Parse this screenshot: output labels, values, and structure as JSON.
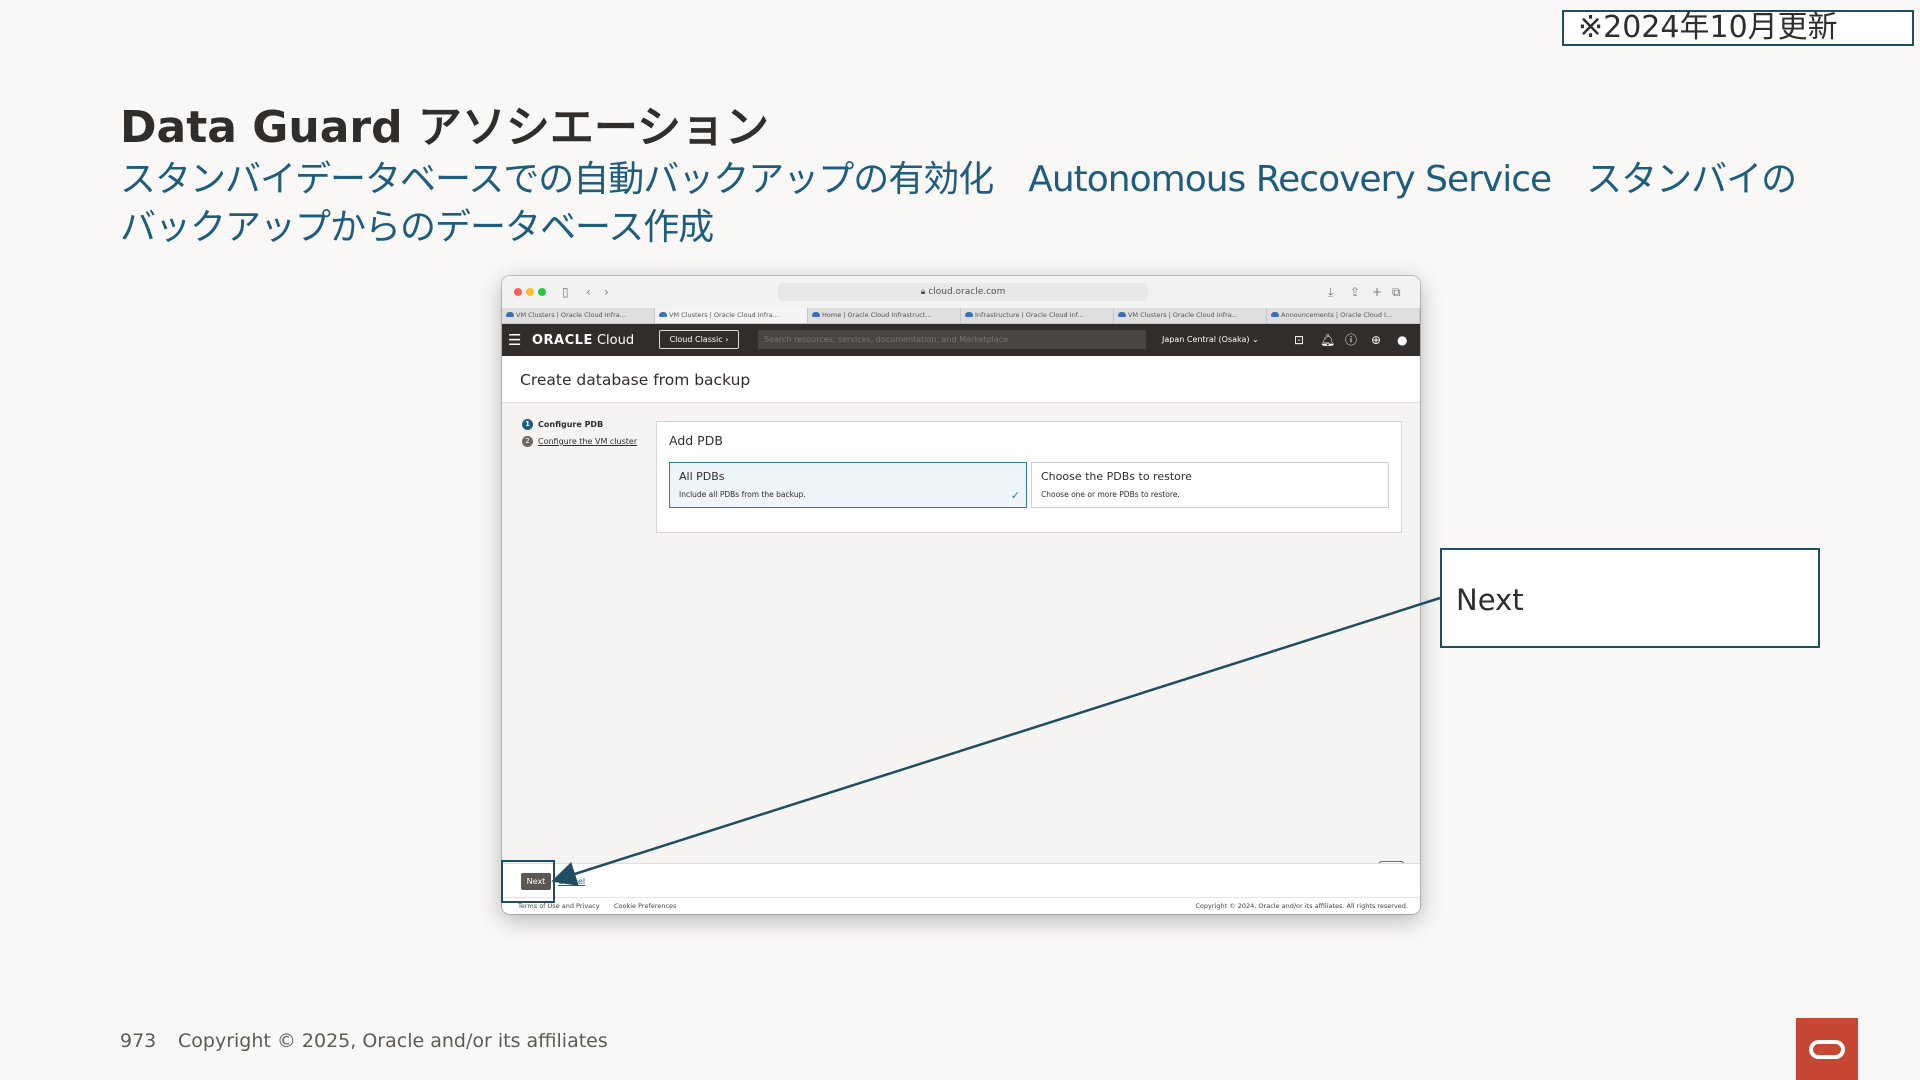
{
  "badge": "※2024年10月更新",
  "slide": {
    "title": "Data Guard アソシエーション",
    "subtitle": "スタンバイデータベースでの自動バックアップの有効化　Autonomous Recovery Service　スタンバイのバックアップからのデータベース作成"
  },
  "browser": {
    "url": "cloud.oracle.com",
    "tabs": [
      {
        "label": "VM Clusters | Oracle Cloud Infra...",
        "active": false
      },
      {
        "label": "VM Clusters | Oracle Cloud Infra...",
        "active": true
      },
      {
        "label": "Home | Oracle Cloud Infrastruct...",
        "active": false
      },
      {
        "label": "Infrastructure | Oracle Cloud Inf...",
        "active": false
      },
      {
        "label": "VM Clusters | Oracle Cloud Infra...",
        "active": false
      },
      {
        "label": "Announcements | Oracle Cloud I...",
        "active": false
      }
    ]
  },
  "console": {
    "logo_brand": "ORACLE",
    "logo_product": "Cloud",
    "classic_button": "Cloud Classic ›",
    "search_placeholder": "Search resources, services, documentation, and Marketplace",
    "region": "Japan Central (Osaka) ⌄",
    "page_title": "Create database from backup",
    "steps": [
      {
        "num": "1",
        "label": "Configure PDB"
      },
      {
        "num": "2",
        "label": "Configure the VM cluster"
      }
    ],
    "panel_title": "Add PDB",
    "options": [
      {
        "title": "All PDBs",
        "desc": "Include all PDBs from the backup.",
        "selected": true
      },
      {
        "title": "Choose the PDBs to restore",
        "desc": "Choose one or more PDBs to restore.",
        "selected": false
      }
    ],
    "next_button": "Next",
    "cancel_link": "Cancel",
    "terms": "Terms of Use and Privacy",
    "cookies": "Cookie Preferences",
    "copyright": "Copyright © 2024, Oracle and/or its affiliates. All rights reserved."
  },
  "callout": {
    "text": "Next"
  },
  "footer": {
    "page_number": "973",
    "copyright": "Copyright © 2025, Oracle and/or its affiliates"
  },
  "colors": {
    "accent": "#1f4e63",
    "subtitle": "#1e5d7e",
    "oracle_red": "#c74634",
    "header_dark": "#312d2a"
  }
}
